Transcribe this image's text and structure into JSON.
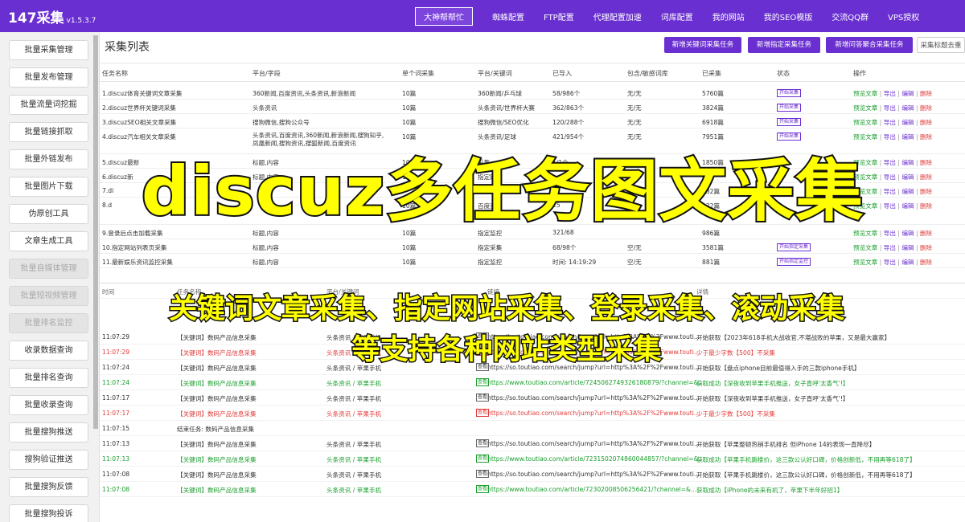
{
  "app": {
    "name": "147采集",
    "version": "v1.5.3.7"
  },
  "topnav": [
    "大神帮帮忙",
    "蜘蛛配置",
    "FTP配置",
    "代理配置加速",
    "词库配置",
    "我的网站",
    "我的SEO模版",
    "交流QQ群",
    "VPS授权"
  ],
  "sidebar": [
    "批量采集管理",
    "批量发布管理",
    "批量流量词挖掘",
    "批量链接抓取",
    "批量外链发布",
    "批量图片下载",
    "伪原创工具",
    "文章生成工具",
    "批量自媒体管理",
    "批量短视频管理",
    "批量排名监控",
    "收录数据查询",
    "批量排名查询",
    "批量收录查询",
    "批量搜狗推送",
    "搜狗验证推送",
    "批量搜狗反馈",
    "批量搜狗投诉"
  ],
  "page_title": "采集列表",
  "toolbar": {
    "add_keyword": "新增关键词采集任务",
    "add_site": "新增指定采集任务",
    "add_aggregate": "新增问答聚合采集任务",
    "cut": "采集标题去重"
  },
  "table": {
    "headers": [
      "任务名称",
      "平台/字段",
      "单个词采集",
      "平台/关键词",
      "已导入",
      "包含/敏感词库",
      "已采集",
      "状态",
      "操作"
    ],
    "rows": [
      {
        "name": "1.discuz体育关键词文章采集",
        "platform": "360新闻,百度资讯,头条资讯,新浪新闻",
        "single": "10篇",
        "kw": "360新闻/乒乓球",
        "imported": "58/986个",
        "filter": "无/无",
        "collected": "5760篇",
        "status": "开始采集"
      },
      {
        "name": "2.discuz世界杯关键词采集",
        "platform": "头条资讯",
        "single": "10篇",
        "kw": "头条资讯/世界杯大赛",
        "imported": "362/863个",
        "filter": "无/无",
        "collected": "3824篇",
        "status": "开始采集"
      },
      {
        "name": "3.discuzSEO相关文章采集",
        "platform": "搜狗微信,搜狗公众号",
        "single": "10篇",
        "kw": "搜狗微信/SEO优化",
        "imported": "120/288个",
        "filter": "无/无",
        "collected": "6918篇",
        "status": "开始采集"
      },
      {
        "name": "4.discuz汽车相关文章采集",
        "platform": "头条资讯,百度资讯,360新闻,新浪新闻,搜狗知乎,凤凰新闻,搜狗资讯,搜狐新闻,百度资讯",
        "single": "10篇",
        "kw": "头条资讯/足球",
        "imported": "421/954个",
        "filter": "无/无",
        "collected": "7951篇",
        "status": "开始采集"
      },
      {
        "name": "5.discuz最新",
        "platform": "标题,内容",
        "single": "10篇",
        "kw": "采集",
        "imported": "1/1个",
        "filter": "",
        "collected": "1850篇",
        "status": ""
      },
      {
        "name": "6.discuz新",
        "platform": "标题,内容",
        "single": "10篇",
        "kw": "指定网",
        "imported": "",
        "filter": "",
        "collected": "",
        "status": ""
      },
      {
        "name": "7.di",
        "platform": "",
        "single": "",
        "kw": "",
        "imported": "",
        "filter": "",
        "collected": "332篇",
        "status": ""
      },
      {
        "name": "8.d",
        "platform": "",
        "single": "10篇",
        "kw": "百度资",
        "imported": "25",
        "filter": "",
        "collected": "122篇",
        "status": ""
      },
      {
        "name": "9.登录后点击加载采集",
        "platform": "标题,内容",
        "single": "10篇",
        "kw": "指定监控",
        "imported": "321/68",
        "filter": "",
        "collected": "986篇",
        "status": ""
      },
      {
        "name": "10.指定网站列表页采集",
        "platform": "标题,内容",
        "single": "10篇",
        "kw": "指定采集",
        "imported": "68/98个",
        "filter": "空/无",
        "collected": "3581篇",
        "status": "开始指定采集"
      },
      {
        "name": "11.最新娱乐资讯监控采集",
        "platform": "标题,内容",
        "single": "10篇",
        "kw": "指定监控",
        "imported": "时间: 14:19:29",
        "filter": "空/无",
        "collected": "881篇",
        "status": "开始指定监控"
      }
    ],
    "ops": [
      "预览文章",
      "导出",
      "编辑",
      "删除"
    ]
  },
  "log": {
    "headers": [
      "时间",
      "任务名称",
      "平台/关键词",
      "链接",
      "详情"
    ],
    "rows": [
      {
        "t": "11:07:29",
        "task": "【关键词】数码产品信息采集",
        "p": "头条资讯 / 苹果手机",
        "url": "https://so.toutiao.com/search/jump?url=http%3A%2F%2Fwww.touti...",
        "d": "开始获取【2023年618手机大战收官,不堪战败的苹果，又是最大赢家】",
        "c": ""
      },
      {
        "t": "11:07:29",
        "task": "【关键词】数码产品信息采集",
        "p": "头条资讯 / 苹果手机",
        "url": "https://so.toutiao.com/search/jump?url=http%3A%2F%2Fwww.touti...",
        "d": "少于最少字数【500】不采集",
        "c": "red"
      },
      {
        "t": "11:07:24",
        "task": "【关键词】数码产品信息采集",
        "p": "头条资讯 / 苹果手机",
        "url": "https://so.toutiao.com/search/jump?url=http%3A%2F%2Fwww.touti...",
        "d": "开始获取【盘点iphone目前最值得入手的三款iphone手机】",
        "c": ""
      },
      {
        "t": "11:07:24",
        "task": "【关键词】数码产品信息采集",
        "p": "头条资讯 / 苹果手机",
        "url": "https://www.toutiao.com/article/7245062749326180879/?channel=&...",
        "d": "获取成功【深夜收到苹果手机推送，女子直呼'太香气'!】",
        "c": "green"
      },
      {
        "t": "11:07:17",
        "task": "【关键词】数码产品信息采集",
        "p": "头条资讯 / 苹果手机",
        "url": "https://so.toutiao.com/search/jump?url=http%3A%2F%2Fwww.touti...",
        "d": "开始获取【深夜收到苹果手机推送，女子直呼'太香气'!】",
        "c": ""
      },
      {
        "t": "11:07:17",
        "task": "【关键词】数码产品信息采集",
        "p": "头条资讯 / 苹果手机",
        "url": "https://so.toutiao.com/search/jump?url=http%3A%2F%2Fwww.touti...",
        "d": "少于最少字数【500】不采集",
        "c": "red"
      },
      {
        "t": "11:07:15",
        "task": "结束任务: 数码产品信息采集",
        "p": "",
        "url": "",
        "d": "",
        "c": ""
      },
      {
        "t": "11:07:13",
        "task": "【关键词】数码产品信息采集",
        "p": "头条资讯 / 苹果手机",
        "url": "https://so.toutiao.com/search/jump?url=http%3A%2F%2Fwww.touti...",
        "d": "开始获取【苹果整顿热销手机排名 但iPhone 14的表现一直降尽】",
        "c": ""
      },
      {
        "t": "11:07:13",
        "task": "【关键词】数码产品信息采集",
        "p": "头条资讯 / 苹果手机",
        "url": "https://www.toutiao.com/article/7231502074860044857/?channel=&...",
        "d": "获取成功【苹果手机跳楼价，这三款公认好口碑，价格创新低，不用再等618了】",
        "c": "green"
      },
      {
        "t": "11:07:08",
        "task": "【关键词】数码产品信息采集",
        "p": "头条资讯 / 苹果手机",
        "url": "https://so.toutiao.com/search/jump?url=http%3A%2F%2Fwww.touti...",
        "d": "开始获取【苹果手机跳楼价，这三款公认好口碑，价格创新低，不用再等618了】",
        "c": ""
      },
      {
        "t": "11:07:08",
        "task": "【关键词】数码产品信息采集",
        "p": "头条资讯 / 苹果手机",
        "url": "https://www.toutiao.com/article/72302008506256421/?channel=&...",
        "d": "获取成功【iPhone的未来有机了，苹果下半年好招1】",
        "c": "green"
      }
    ],
    "tag": "查看"
  },
  "overlay": {
    "headline": "discuz多任务图文采集",
    "line1": "关键词文章采集、指定网站采集、登录采集、滚动采集",
    "line2": "等支持各种网站类型采集"
  }
}
